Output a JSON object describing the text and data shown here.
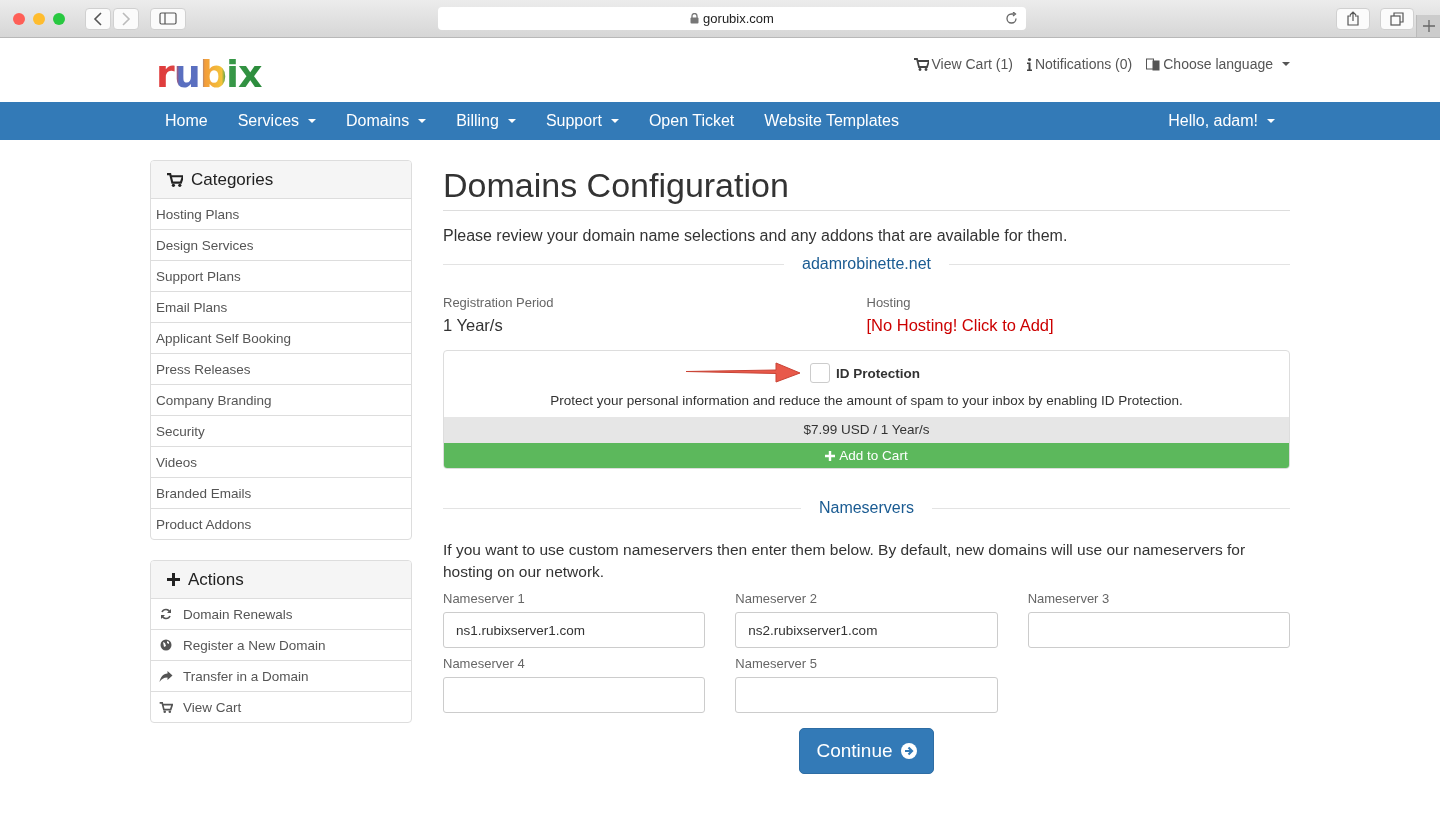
{
  "browser": {
    "url": "gorubix.com"
  },
  "header": {
    "logo": "rubix",
    "links": [
      {
        "kind": "cart",
        "label": "View Cart (1)",
        "dropdown": false
      },
      {
        "kind": "info",
        "label": "Notifications (0)",
        "dropdown": false
      },
      {
        "kind": "language",
        "label": "Choose language",
        "dropdown": true
      }
    ]
  },
  "nav": {
    "items": [
      {
        "label": "Home",
        "dropdown": false
      },
      {
        "label": "Services",
        "dropdown": true
      },
      {
        "label": "Domains",
        "dropdown": true
      },
      {
        "label": "Billing",
        "dropdown": true
      },
      {
        "label": "Support",
        "dropdown": true
      },
      {
        "label": "Open Ticket",
        "dropdown": false
      },
      {
        "label": "Website Templates",
        "dropdown": false
      }
    ],
    "user": {
      "label": "Hello, adam!",
      "dropdown": true
    }
  },
  "sidebar": {
    "panels": [
      {
        "kind": "cart",
        "title": "Categories",
        "items": [
          {
            "label": "Hosting Plans"
          },
          {
            "label": "Design Services"
          },
          {
            "label": "Support Plans"
          },
          {
            "label": "Email Plans"
          },
          {
            "label": "Applicant Self Booking"
          },
          {
            "label": "Press Releases"
          },
          {
            "label": "Company Branding"
          },
          {
            "label": "Security"
          },
          {
            "label": "Videos"
          },
          {
            "label": "Branded Emails"
          },
          {
            "label": "Product Addons"
          }
        ]
      },
      {
        "kind": "plus",
        "title": "Actions",
        "items": [
          {
            "label": "Domain Renewals"
          },
          {
            "label": "Register a New Domain"
          },
          {
            "label": "Transfer in a Domain"
          },
          {
            "label": "View Cart"
          }
        ]
      }
    ]
  },
  "main": {
    "title": "Domains Configuration",
    "intro": "Please review your domain name selections and any addons that are available for them.",
    "domain": "adamrobinette.net",
    "registration": {
      "label": "Registration Period",
      "value": "1 Year/s"
    },
    "hosting": {
      "label": "Hosting",
      "value": "[No Hosting! Click to Add]"
    },
    "addon": {
      "name": "ID Protection",
      "checked": false,
      "description": "Protect your personal information and reduce the amount of spam to your inbox by enabling ID Protection.",
      "price": "$7.99 USD / 1 Year/s",
      "button": "Add to Cart"
    },
    "nameservers": {
      "heading": "Nameservers",
      "intro": "If you want to use custom nameservers then enter them below. By default, new domains will use our nameservers for hosting on our network.",
      "fields": [
        {
          "label": "Nameserver 1",
          "value": "ns1.rubixserver1.com"
        },
        {
          "label": "Nameserver 2",
          "value": "ns2.rubixserver1.com"
        },
        {
          "label": "Nameserver 3"
        },
        {
          "label": "Nameserver 4"
        },
        {
          "label": "Nameserver 5"
        }
      ]
    },
    "continue": "Continue"
  }
}
